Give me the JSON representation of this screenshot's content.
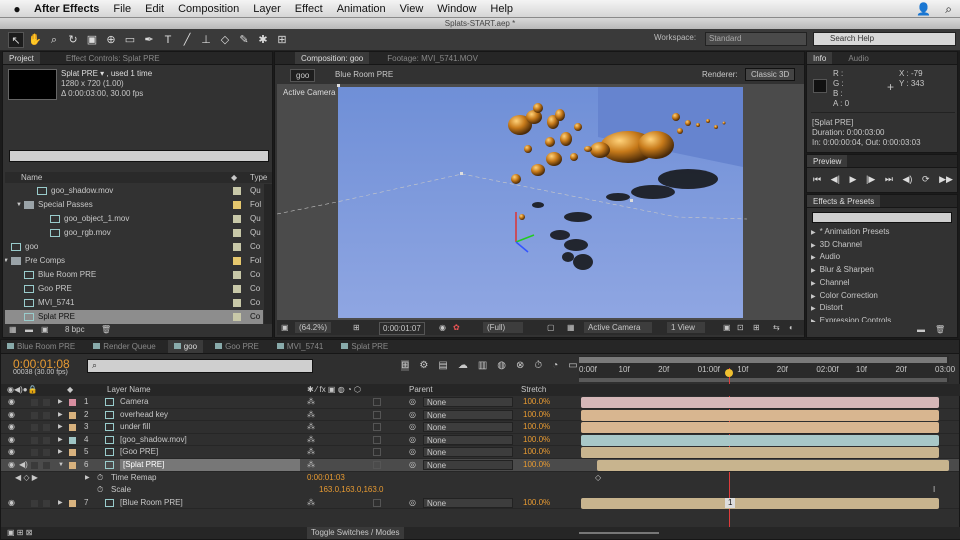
{
  "menubar": {
    "app": "After Effects",
    "items": [
      "File",
      "Edit",
      "Composition",
      "Layer",
      "Effect",
      "Animation",
      "View",
      "Window",
      "Help"
    ]
  },
  "window_title": "Splats-START.aep *",
  "toolbar": {
    "workspace_label": "Workspace:",
    "workspace_value": "Standard",
    "search_placeholder": "Search Help"
  },
  "project": {
    "tab": "Project",
    "tab_effect": "Effect Controls: Splat PRE",
    "selected_name": "Splat PRE ▾ , used 1 time",
    "selected_dims": "1280 x 720 (1.00)",
    "selected_dur": "Δ 0:00:03:00, 30.00 fps",
    "col_name": "Name",
    "col_type": "Type",
    "bpc": "8 bpc",
    "items": [
      {
        "name": "goo_shadow.mov",
        "type": "Qu",
        "kind": "file",
        "indent": 2,
        "color": "#c8c8a8"
      },
      {
        "name": "Special Passes",
        "type": "Fol",
        "kind": "folder",
        "indent": 1,
        "color": "#e6c86e"
      },
      {
        "name": "goo_object_1.mov",
        "type": "Qu",
        "kind": "file",
        "indent": 3,
        "color": "#c8c8a8"
      },
      {
        "name": "goo_rgb.mov",
        "type": "Qu",
        "kind": "file",
        "indent": 3,
        "color": "#c8c8a8"
      },
      {
        "name": "goo",
        "type": "Co",
        "kind": "comp",
        "indent": 0,
        "color": "#c8c8a8"
      },
      {
        "name": "Pre Comps",
        "type": "Fol",
        "kind": "folder",
        "indent": 0,
        "color": "#e6c86e"
      },
      {
        "name": "Blue Room PRE",
        "type": "Co",
        "kind": "comp",
        "indent": 1,
        "color": "#c8c8a8"
      },
      {
        "name": "Goo PRE",
        "type": "Co",
        "kind": "comp",
        "indent": 1,
        "color": "#c8c8a8"
      },
      {
        "name": "MVI_5741",
        "type": "Co",
        "kind": "comp",
        "indent": 1,
        "color": "#c8c8a8"
      },
      {
        "name": "Splat PRE",
        "type": "Co",
        "kind": "comp",
        "indent": 1,
        "color": "#c8c8a8",
        "selected": true
      }
    ]
  },
  "composition": {
    "tab": "Composition: goo",
    "tab_footage": "Footage: MVI_5741.MOV",
    "crumb1": "goo",
    "crumb2": "Blue Room PRE",
    "renderer_label": "Renderer:",
    "renderer_value": "Classic 3D",
    "camera_label": "Active Camera",
    "zoom": "(64.2%)",
    "timecode": "0:00:01:07",
    "resolution": "(Full)",
    "view_camera": "Active Camera",
    "views": "1 View"
  },
  "info": {
    "tab": "Info",
    "tab_audio": "Audio",
    "r": "R :",
    "g": "G :",
    "b": "B :",
    "a": "A :  0",
    "x": "X : -79",
    "y": "Y : 343",
    "name": "[Splat PRE]",
    "duration": "Duration: 0:00:03:00",
    "inout": "In: 0:00:00:04, Out: 0:00:03:03"
  },
  "preview": {
    "tab": "Preview"
  },
  "effects": {
    "tab": "Effects & Presets",
    "search_placeholder": "",
    "items": [
      "* Animation Presets",
      "3D Channel",
      "Audio",
      "Blur & Sharpen",
      "Channel",
      "Color Correction",
      "Distort",
      "Expression Controls"
    ]
  },
  "timeline_tabs": [
    "Blue Room PRE",
    "Render Queue",
    "goo",
    "Goo PRE",
    "MVI_5741",
    "Splat PRE"
  ],
  "timeline": {
    "timecode": "0:00:01:08",
    "frames": "00038 (30.00 fps)",
    "col_layer": "Layer Name",
    "col_parent": "Parent",
    "col_stretch": "Stretch",
    "ruler": [
      "0:00f",
      "10f",
      "20f",
      "01:00f",
      "10f",
      "20f",
      "02:00f",
      "10f",
      "20f",
      "03:00"
    ],
    "layers": [
      {
        "num": "1",
        "name": "Camera",
        "parent": "None",
        "stretch": "100.0%",
        "label": "#d88ea0",
        "bar": "#d5b7b8"
      },
      {
        "num": "2",
        "name": "overhead key",
        "parent": "None",
        "stretch": "100.0%",
        "label": "#d8b27e",
        "bar": "#d8b690"
      },
      {
        "num": "3",
        "name": "under fill",
        "parent": "None",
        "stretch": "100.0%",
        "label": "#d8b27e",
        "bar": "#d8b690"
      },
      {
        "num": "4",
        "name": "[goo_shadow.mov]",
        "parent": "None",
        "stretch": "100.0%",
        "label": "#9fc5c5",
        "bar": "#a8c8c8"
      },
      {
        "num": "5",
        "name": "[Goo PRE]",
        "parent": "None",
        "stretch": "100.0%",
        "label": "#d8b27e",
        "bar": "#c8b48e"
      },
      {
        "num": "6",
        "name": "[Splat PRE]",
        "parent": "None",
        "stretch": "100.0%",
        "label": "#d8b27e",
        "bar": "#c8b48e"
      },
      {
        "num": "7",
        "name": "[Blue Room PRE]",
        "parent": "None",
        "stretch": "100.0%",
        "label": "#d8b27e",
        "bar": "#c8b48e"
      }
    ],
    "time_remap_label": "Time Remap",
    "time_remap_value": "0:00:01:03",
    "scale_label": "Scale",
    "scale_value": "163.0,163.0,163.0",
    "toggle_label": "Toggle Switches / Modes",
    "keyframe_label": "1"
  }
}
